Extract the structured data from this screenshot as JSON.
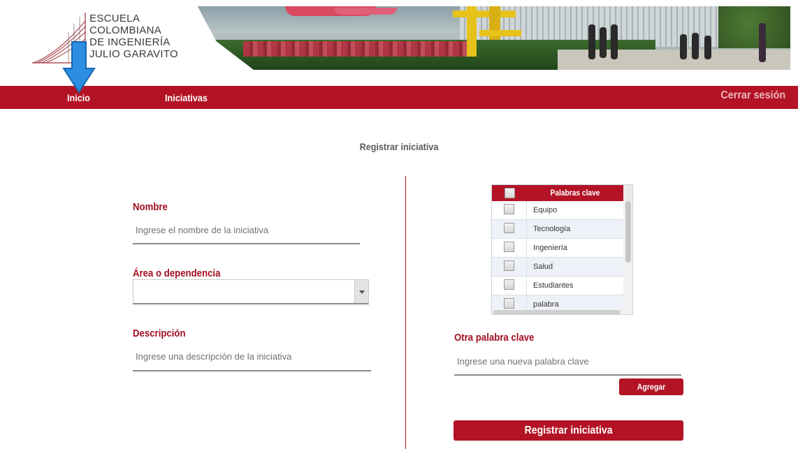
{
  "logo": {
    "lines": [
      "ESCUELA",
      "COLOMBIANA",
      "DE INGENIERÍA",
      "JULIO GARAVITO"
    ]
  },
  "nav": {
    "items": [
      {
        "label": "Inicio"
      },
      {
        "label": "Iniciativas"
      }
    ],
    "logout_label": "Cerrar sesión",
    "bar_color": "#b31325"
  },
  "page": {
    "title": "Registrar iniciativa"
  },
  "form": {
    "name": {
      "label": "Nombre",
      "placeholder": "Ingrese el nombre de la iniciativa"
    },
    "area": {
      "label": "Área o dependencia",
      "value": ""
    },
    "description": {
      "label": "Descripción",
      "placeholder": "Ingrese una descripción de la iniciativa"
    },
    "keywords": {
      "header": "Palabras clave",
      "items": [
        {
          "label": "Equipo"
        },
        {
          "label": "Tecnología"
        },
        {
          "label": "Ingeniería"
        },
        {
          "label": "Salud"
        },
        {
          "label": "Estudiantes"
        },
        {
          "label": "palabra"
        }
      ]
    },
    "other_keyword": {
      "label": "Otra palabra clave",
      "placeholder": "Ingrese una nueva palabra clave",
      "add_label": "Agregar"
    },
    "submit_label": "Registrar iniciativa"
  },
  "icons": {
    "annotation_arrow": "down-arrow-icon",
    "select_caret": "chevron-down-icon",
    "checkbox": "checkbox-icon"
  }
}
